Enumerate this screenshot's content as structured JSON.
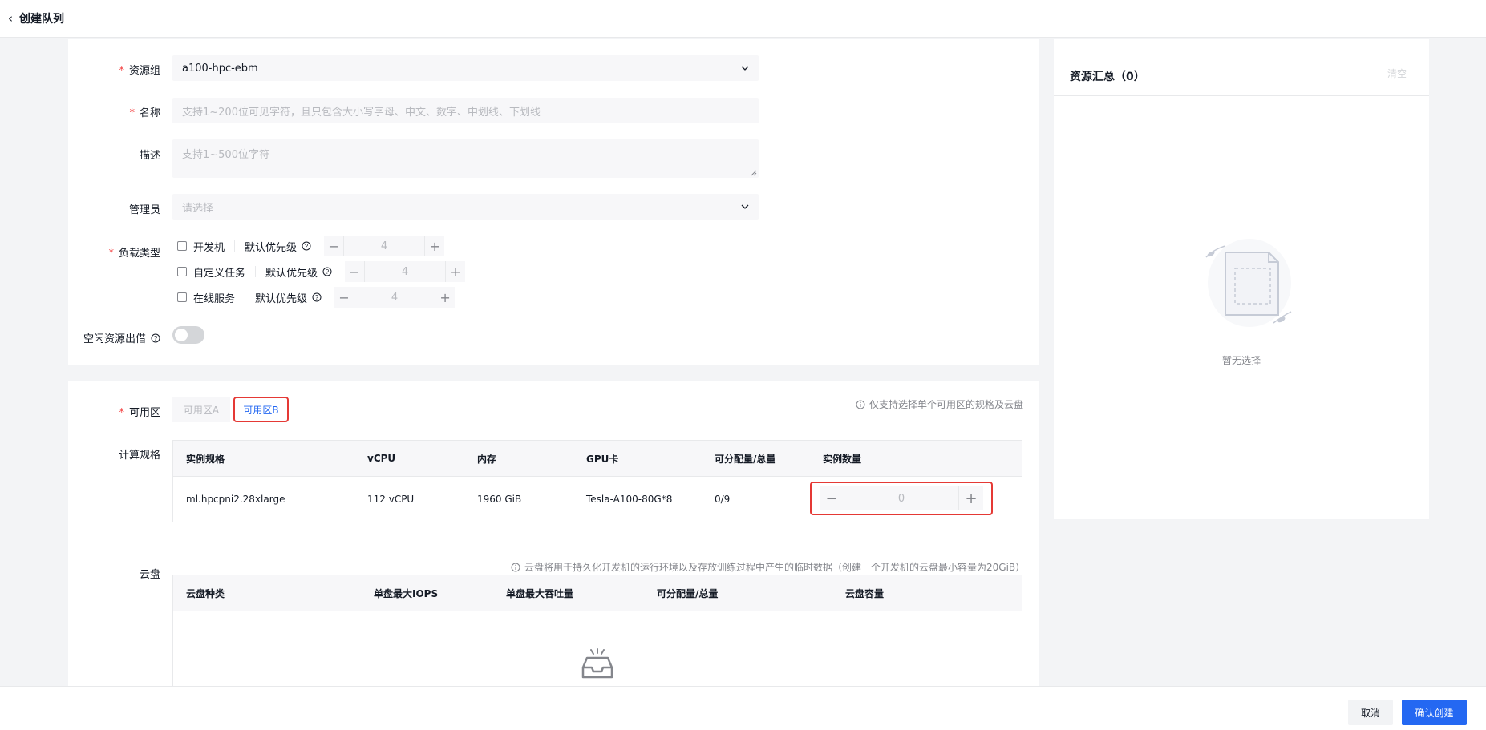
{
  "header": {
    "title": "创建队列"
  },
  "form": {
    "resource_group": {
      "label": "资源组",
      "value": "a100-hpc-ebm"
    },
    "name": {
      "label": "名称",
      "placeholder": "支持1~200位可见字符，且只包含大小写字母、中文、数字、中划线、下划线"
    },
    "description": {
      "label": "描述",
      "placeholder": "支持1~500位字符"
    },
    "admin": {
      "label": "管理员",
      "placeholder": "请选择"
    },
    "workload": {
      "label": "负载类型",
      "items": [
        {
          "name": "开发机",
          "priority_label": "默认优先级",
          "priority": "4"
        },
        {
          "name": "自定义任务",
          "priority_label": "默认优先级",
          "priority": "4"
        },
        {
          "name": "在线服务",
          "priority_label": "默认优先级",
          "priority": "4"
        }
      ]
    },
    "idle_lend": {
      "label": "空闲资源出借",
      "enabled": false
    }
  },
  "zone": {
    "label": "可用区",
    "options": [
      "可用区A",
      "可用区B"
    ],
    "selected": "可用区B",
    "tip": "仅支持选择单个可用区的规格及云盘"
  },
  "compute": {
    "label": "计算规格",
    "columns": [
      "实例规格",
      "vCPU",
      "内存",
      "GPU卡",
      "可分配量/总量",
      "实例数量"
    ],
    "rows": [
      {
        "spec": "ml.hpcpni2.28xlarge",
        "vcpu": "112 vCPU",
        "mem": "1960 GiB",
        "gpu": "Tesla-A100-80G*8",
        "quota": "0/9",
        "count": "0"
      }
    ]
  },
  "disk": {
    "label": "云盘",
    "tip": "云盘将用于持久化开发机的运行环境以及存放训练过程中产生的临时数据（创建一个开发机的云盘最小容量为20GiB）",
    "columns": [
      "云盘种类",
      "单盘最大IOPS",
      "单盘最大吞吐量",
      "可分配量/总量",
      "云盘容量"
    ]
  },
  "summary": {
    "title": "资源汇总（0）",
    "clear": "清空",
    "empty": "暂无选择"
  },
  "footer": {
    "cancel": "取消",
    "confirm": "确认创建"
  },
  "colors": {
    "primary": "#2468f2",
    "required": "#f33e3e",
    "highlight": "#e53935"
  }
}
